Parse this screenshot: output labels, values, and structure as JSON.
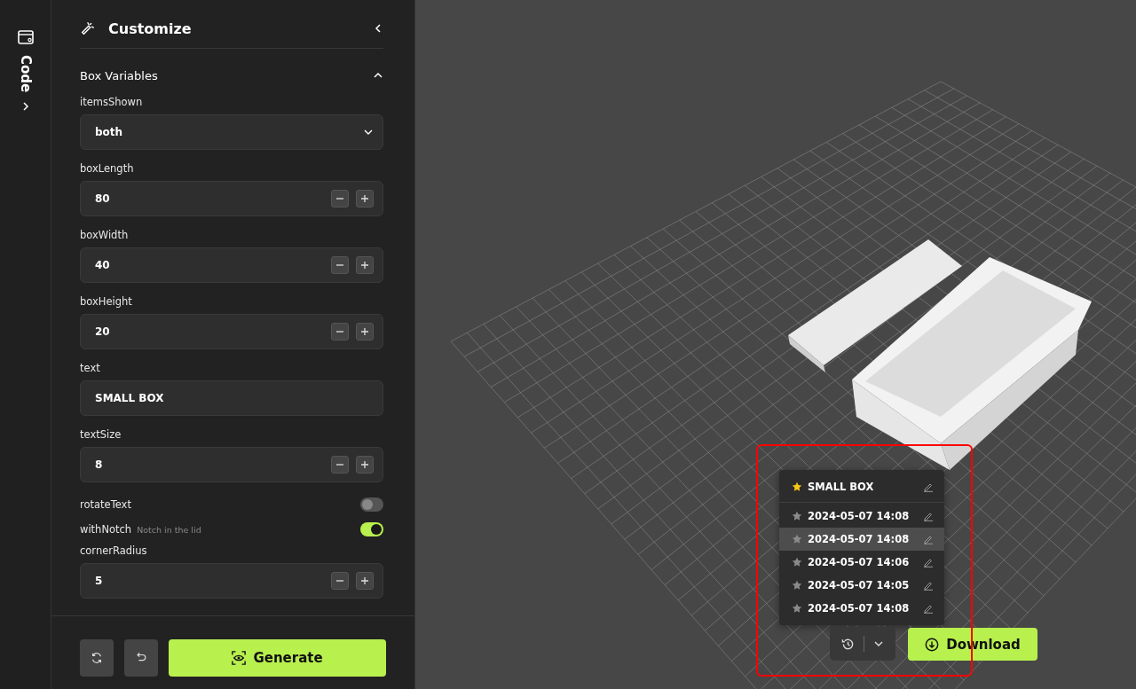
{
  "rail": {
    "label": "Code"
  },
  "panel": {
    "title": "Customize",
    "section": {
      "title": "Box Variables",
      "expanded": true
    },
    "fields": [
      {
        "kind": "select",
        "label": "itemsShown",
        "value": "both"
      },
      {
        "kind": "number",
        "label": "boxLength",
        "value": "80"
      },
      {
        "kind": "number",
        "label": "boxWidth",
        "value": "40"
      },
      {
        "kind": "number",
        "label": "boxHeight",
        "value": "20"
      },
      {
        "kind": "text",
        "label": "text",
        "value": "SMALL BOX"
      },
      {
        "kind": "number",
        "label": "textSize",
        "value": "8"
      },
      {
        "kind": "toggle",
        "label": "rotateText",
        "on": false
      },
      {
        "kind": "toggle",
        "label": "withNotch",
        "hint": "Notch in the lid",
        "on": true
      },
      {
        "kind": "number",
        "label": "cornerRadius",
        "value": "5"
      }
    ],
    "generate": "Generate"
  },
  "history": {
    "pinned": {
      "label": "SMALL BOX",
      "starred": true
    },
    "items": [
      {
        "label": "2024-05-07 14:08",
        "starred": false,
        "selected": false
      },
      {
        "label": "2024-05-07 14:08",
        "starred": false,
        "selected": true
      },
      {
        "label": "2024-05-07 14:06",
        "starred": false,
        "selected": false
      },
      {
        "label": "2024-05-07 14:05",
        "starred": false,
        "selected": false
      },
      {
        "label": "2024-05-07 14:08",
        "starred": false,
        "selected": false
      }
    ]
  },
  "download": "Download"
}
